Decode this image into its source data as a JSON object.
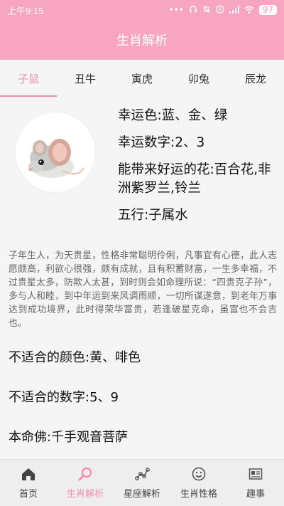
{
  "status_bar": {
    "time": "上午9:15",
    "battery": "97"
  },
  "app_bar": {
    "title": "生肖解析"
  },
  "tabs": [
    {
      "label": "子鼠",
      "active": true
    },
    {
      "label": "丑牛",
      "active": false
    },
    {
      "label": "寅虎",
      "active": false
    },
    {
      "label": "卯兔",
      "active": false
    },
    {
      "label": "辰龙",
      "active": false
    }
  ],
  "summary": {
    "lucky_color": "幸运色:蓝、金、绿",
    "lucky_number": "幸运数字:2、3",
    "lucky_flower": "能带来好运的花:百合花,非洲紫罗兰,铃兰",
    "element": "五行:子属水"
  },
  "description": "子年生人，为天贵星，性格非常聪明伶俐，凡事宜有心德，此人志愿颇高，利欲心很强，颇有成就，且有积蓄财富，一生多幸福，不过贵星太多，防欺人太甚，到时则会如命理所说：“四贵克子孙”，多与人和睦，到中年运到来风调雨顺，一切所谋遂意，到老年万事达到成功境界，此时得荣华富贵，若逢破星克命，虽富也不会吉也。",
  "notes": {
    "unlucky_color": "不适合的颜色:黄、啡色",
    "unlucky_number": "不适合的数字:5、9",
    "guardian_buddha": "本命佛:千手观音菩萨"
  },
  "bottom_nav": [
    {
      "label": "首页",
      "icon": "home-icon",
      "active": false
    },
    {
      "label": "生肖解析",
      "icon": "search-icon",
      "active": true
    },
    {
      "label": "星座解析",
      "icon": "constellation-icon",
      "active": false
    },
    {
      "label": "生肖性格",
      "icon": "smile-icon",
      "active": false
    },
    {
      "label": "趣事",
      "icon": "news-icon",
      "active": false
    }
  ],
  "colors": {
    "accent": "#f8a5c2",
    "active": "#f48fb1"
  }
}
